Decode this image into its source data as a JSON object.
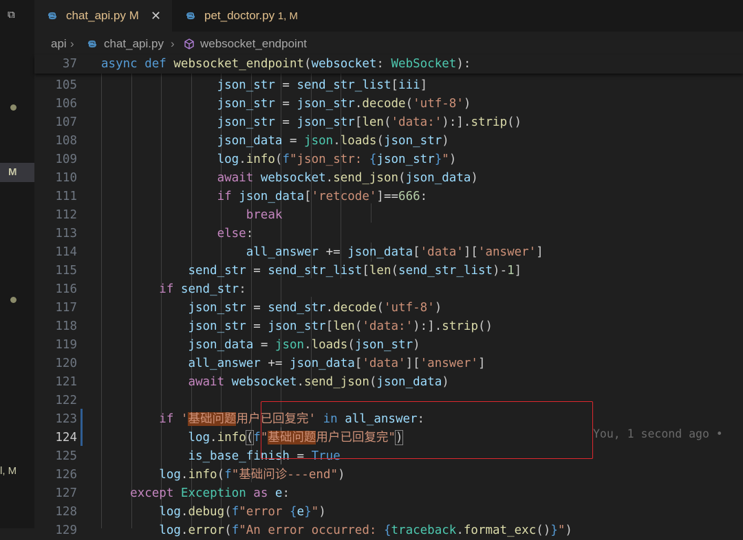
{
  "sidebar": {
    "m_badge": "M",
    "bottom_label": "l, M"
  },
  "tabs": [
    {
      "name": "chat_api.py",
      "badge": "M"
    },
    {
      "name": "pet_doctor.py",
      "badge": "1, M"
    }
  ],
  "breadcrumb": {
    "folder": "api",
    "file": "chat_api.py",
    "symbol": "websocket_endpoint"
  },
  "blame": "You, 1 second ago •"
}
